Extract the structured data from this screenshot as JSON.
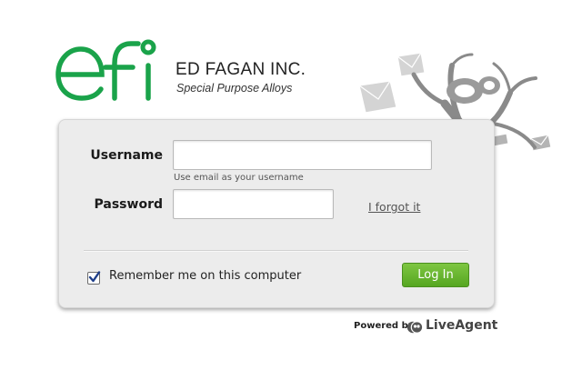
{
  "brand": {
    "logo_text": "efi",
    "company_name": "ED FAGAN INC.",
    "tagline": "Special Purpose Alloys",
    "logo_color": "#1aa34a"
  },
  "form": {
    "username_label": "Username",
    "username_value": "",
    "username_hint": "Use email as your username",
    "password_label": "Password",
    "password_value": "",
    "forgot_link": "I forgot it",
    "remember_label": "Remember me on this computer",
    "remember_checked": true,
    "login_button": "Log In",
    "accent_color": "#5aaa26"
  },
  "footer": {
    "powered_by": "Powered by",
    "product": "LiveAgent",
    "icon": "liveagent-logo-icon"
  },
  "decoration": {
    "icon": "tree-envelopes-decoration-icon"
  }
}
